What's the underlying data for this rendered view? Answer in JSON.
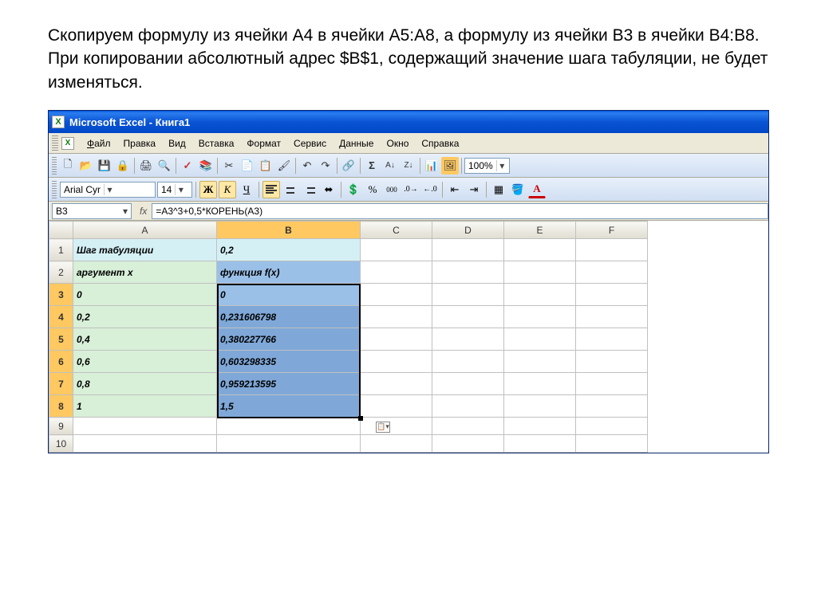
{
  "doc": {
    "para1": "Скопируем формулу из ячейки А4 в ячейки А5:А8, а формулу из ячейки В3 в ячейки В4:В8.",
    "para2": "При копировании абсолютный адрес $B$1, содержащий значение шага табуляции, не будет изменяться."
  },
  "window": {
    "title": "Microsoft Excel - Книга1"
  },
  "menu": {
    "file": "Файл",
    "edit": "Правка",
    "view": "Вид",
    "insert": "Вставка",
    "format": "Формат",
    "tools": "Сервис",
    "data": "Данные",
    "window": "Окно",
    "help": "Справка"
  },
  "toolbar": {
    "zoom": "100%"
  },
  "fontbar": {
    "font": "Arial Cyr",
    "size": "14",
    "bold": "Ж",
    "italic": "К",
    "underline": "Ч",
    "currency": "%",
    "comma": "000"
  },
  "formulabar": {
    "cellref": "B3",
    "fx": "fx",
    "formula": "=A3^3+0,5*КОРЕНЬ(A3)"
  },
  "columns": [
    "A",
    "B",
    "C",
    "D",
    "E",
    "F"
  ],
  "rows": [
    {
      "n": "1",
      "A": "Шаг табуляции",
      "B": "0,2"
    },
    {
      "n": "2",
      "A": "аргумент x",
      "B": "функция f(x)"
    },
    {
      "n": "3",
      "A": "0",
      "B": "0"
    },
    {
      "n": "4",
      "A": "0,2",
      "B": "0,231606798"
    },
    {
      "n": "5",
      "A": "0,4",
      "B": "0,380227766"
    },
    {
      "n": "6",
      "A": "0,6",
      "B": "0,603298335"
    },
    {
      "n": "7",
      "A": "0,8",
      "B": "0,959213595"
    },
    {
      "n": "8",
      "A": "1",
      "B": "1,5"
    },
    {
      "n": "9",
      "A": "",
      "B": ""
    },
    {
      "n": "10",
      "A": "",
      "B": ""
    }
  ]
}
